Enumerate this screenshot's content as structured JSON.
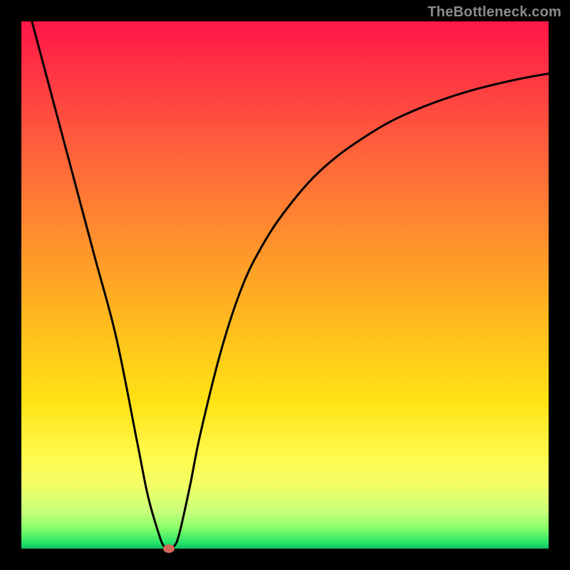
{
  "watermark": "TheBottleneck.com",
  "chart_data": {
    "type": "line",
    "title": "",
    "xlabel": "",
    "ylabel": "",
    "xlim": [
      0,
      100
    ],
    "ylim": [
      0,
      100
    ],
    "series": [
      {
        "name": "curve",
        "x": [
          2,
          6,
          10,
          14,
          18,
          22,
          24,
          26,
          27,
          28,
          29,
          30,
          32,
          34,
          38,
          42,
          46,
          50,
          55,
          60,
          65,
          70,
          75,
          80,
          85,
          90,
          95,
          100
        ],
        "y": [
          100,
          85,
          70,
          55,
          40,
          20,
          10,
          3,
          0.5,
          0,
          0.5,
          3,
          12,
          22,
          38,
          50,
          58,
          64,
          70,
          74.5,
          78,
          81,
          83.3,
          85.2,
          86.8,
          88.1,
          89.2,
          90.1
        ]
      }
    ],
    "min_point": {
      "x": 28,
      "y": 0
    },
    "background_gradient": {
      "top": "#ff1648",
      "mid_upper": "#ff8c2e",
      "mid": "#ffe214",
      "mid_lower": "#c7ff7a",
      "bottom": "#0fbf61"
    }
  }
}
